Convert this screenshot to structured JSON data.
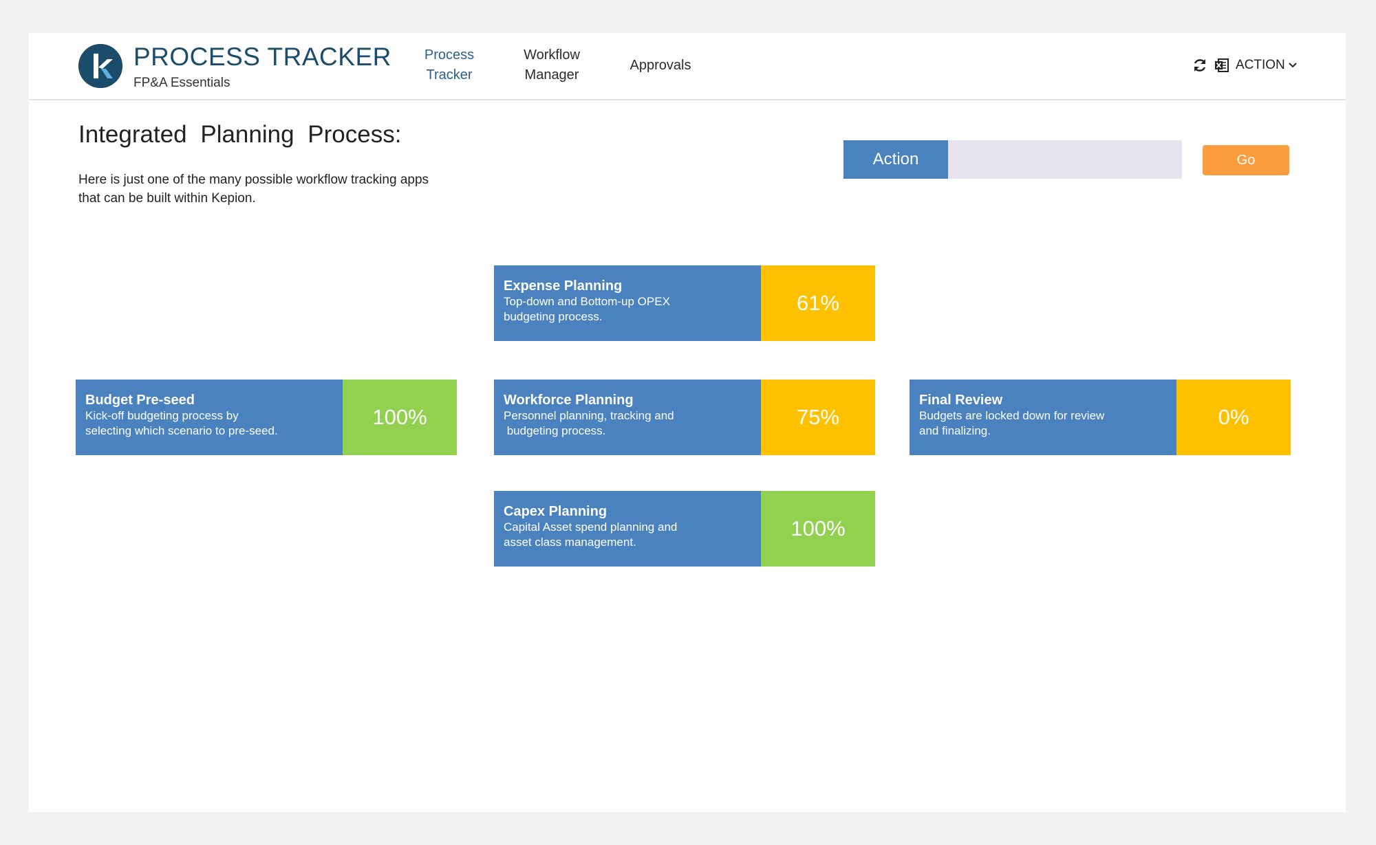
{
  "header": {
    "title": "PROCESS TRACKER",
    "subtitle": "FP&A Essentials",
    "nav": [
      {
        "line1": "Process",
        "line2": "Tracker"
      },
      {
        "line1": "Workflow",
        "line2": "Manager"
      },
      {
        "label": "Approvals"
      }
    ],
    "tools": {
      "refresh_icon": "refresh-icon",
      "excel_icon": "excel-icon",
      "action_label": "ACTION"
    }
  },
  "intro": {
    "title": "Integrated Planning Process:",
    "desc_line1": "Here is just one of the many possible workflow tracking apps",
    "desc_line2": "that can be built within Kepion."
  },
  "action_bar": {
    "label": "Action",
    "input_value": "",
    "go_label": "Go"
  },
  "cards": {
    "expense": {
      "title": "Expense Planning",
      "desc_line1": "Top-down and Bottom-up OPEX",
      "desc_line2": "budgeting process.",
      "pct": "61%"
    },
    "budget": {
      "title": "Budget Pre-seed",
      "desc_line1": "Kick-off budgeting process by",
      "desc_line2": "selecting which scenario to pre-seed.",
      "pct": "100%"
    },
    "workforce": {
      "title": "Workforce Planning",
      "desc_line1": "Personnel planning, tracking and",
      "desc_line2": " budgeting process.",
      "pct": "75%"
    },
    "final": {
      "title": "Final Review",
      "desc_line1": "Budgets are locked down for review",
      "desc_line2": "and finalizing.",
      "pct": "0%"
    },
    "capex": {
      "title": "Capex Planning",
      "desc_line1": "Capital Asset spend planning and",
      "desc_line2": "asset class management.",
      "pct": "100%"
    }
  },
  "colors": {
    "card_blue": "#4a82bf",
    "complete_green": "#92d050",
    "in_progress_yellow": "#ffc000",
    "go_orange": "#fb9c3e",
    "brand_navy": "#1c4c6b"
  }
}
